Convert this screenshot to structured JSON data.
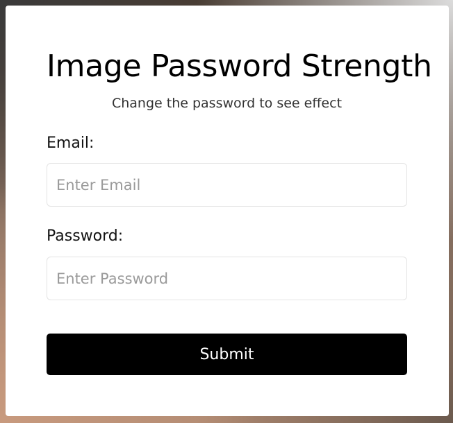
{
  "form": {
    "title": "Image Password Strength",
    "subtitle": "Change the password to see effect",
    "email": {
      "label": "Email:",
      "value": "",
      "placeholder": "Enter Email"
    },
    "password": {
      "label": "Password:",
      "value": "",
      "placeholder": "Enter Password"
    },
    "submit_label": "Submit"
  },
  "colors": {
    "button_background": "#000000",
    "button_text": "#ffffff",
    "card_background": "#ffffff",
    "input_border": "#e3e3e3"
  }
}
